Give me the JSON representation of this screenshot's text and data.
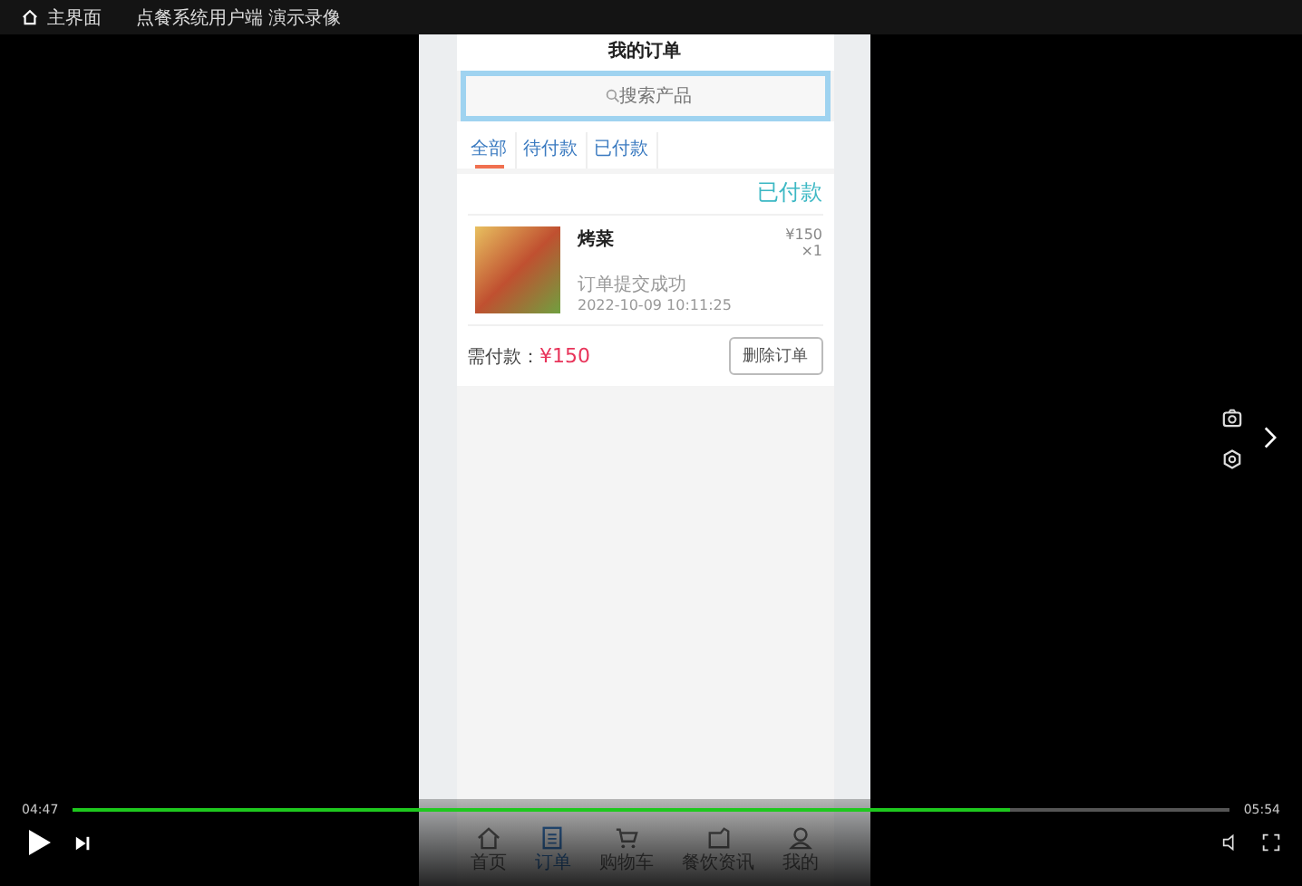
{
  "top_bar": {
    "home_label": "主界面",
    "video_title": "点餐系统用户端 演示录像"
  },
  "app": {
    "title": "我的订单",
    "search": {
      "placeholder": "搜索产品"
    },
    "tabs": [
      {
        "label": "全部",
        "selected": true
      },
      {
        "label": "待付款",
        "selected": false
      },
      {
        "label": "已付款",
        "selected": false
      }
    ],
    "orders": [
      {
        "status": "已付款",
        "name": "烤菜",
        "price": "¥150",
        "quantity": "×1",
        "note": "订单提交成功",
        "time": "2022-10-09 10:11:25",
        "total_label": "需付款：",
        "total": "¥150",
        "action": "删除订单"
      }
    ],
    "nav": [
      {
        "label": "首页",
        "kind": "home",
        "selected": false
      },
      {
        "label": "订单",
        "kind": "order",
        "selected": true
      },
      {
        "label": "购物车",
        "kind": "cart",
        "selected": false
      },
      {
        "label": "餐饮资讯",
        "kind": "news",
        "selected": false
      },
      {
        "label": "我的",
        "kind": "profile",
        "selected": false
      }
    ]
  },
  "player": {
    "elapsed": "04:47",
    "duration": "05:54",
    "level": 0.81
  }
}
